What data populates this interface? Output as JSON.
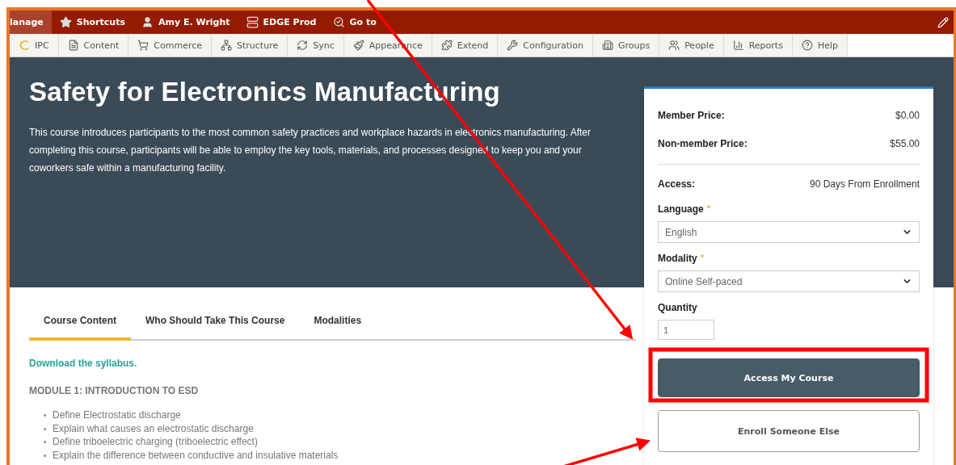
{
  "toolbar": {
    "items": [
      {
        "label": "lanage",
        "selected": true
      },
      {
        "label": "Shortcuts",
        "selected": false
      },
      {
        "label": "Amy E. Wright",
        "selected": false
      },
      {
        "label": "EDGE Prod",
        "selected": false
      },
      {
        "label": "Go to",
        "selected": false
      }
    ]
  },
  "menu": [
    "IPC",
    "Content",
    "Commerce",
    "Structure",
    "Sync",
    "Appearance",
    "Extend",
    "Configuration",
    "Groups",
    "People",
    "Reports",
    "Help"
  ],
  "course": {
    "title": "Safety for Electronics Manufacturing",
    "description": "This course introduces participants to the most common safety practices and workplace hazards in electronics manufacturing. After completing this course, participants will be able to employ the key tools, materials, and processes designed to keep you and your coworkers safe within a manufacturing facility."
  },
  "tabs": [
    {
      "label": "Course Content",
      "selected": true
    },
    {
      "label": "Who Should Take This Course",
      "selected": false
    },
    {
      "label": "Modalities",
      "selected": false
    }
  ],
  "content": {
    "link": "Download the syllabus.",
    "module": "MODULE 1: INTRODUCTION TO ESD",
    "bullets": [
      "Define Electrostatic discharge",
      "Explain what causes an electrostatic discharge",
      "Define triboelectric charging (triboelectric effect)",
      "Explain the difference between conductive and insulative materials"
    ]
  },
  "purchase": {
    "prices": [
      {
        "label": "Member Price:",
        "value": "$0.00"
      },
      {
        "label": "Non-member Price:",
        "value": "$55.00"
      }
    ],
    "access": {
      "label": "Access:",
      "value": "90 Days From Enrollment"
    },
    "selects": [
      {
        "label": "Language",
        "mark": "*",
        "value": "English"
      },
      {
        "label": "Modality",
        "mark": "*",
        "value": "Online Self-paced"
      }
    ],
    "quantity": {
      "label": "Quantity",
      "value": "1"
    },
    "buttons": [
      {
        "label": "Access My Course",
        "kind": "primary"
      },
      {
        "label": "Enroll Someone Else",
        "kind": "outline"
      }
    ]
  },
  "annotations": [
    {
      "kind": "arrow"
    },
    {
      "kind": "arrow"
    },
    {
      "kind": "highlight"
    }
  ]
}
